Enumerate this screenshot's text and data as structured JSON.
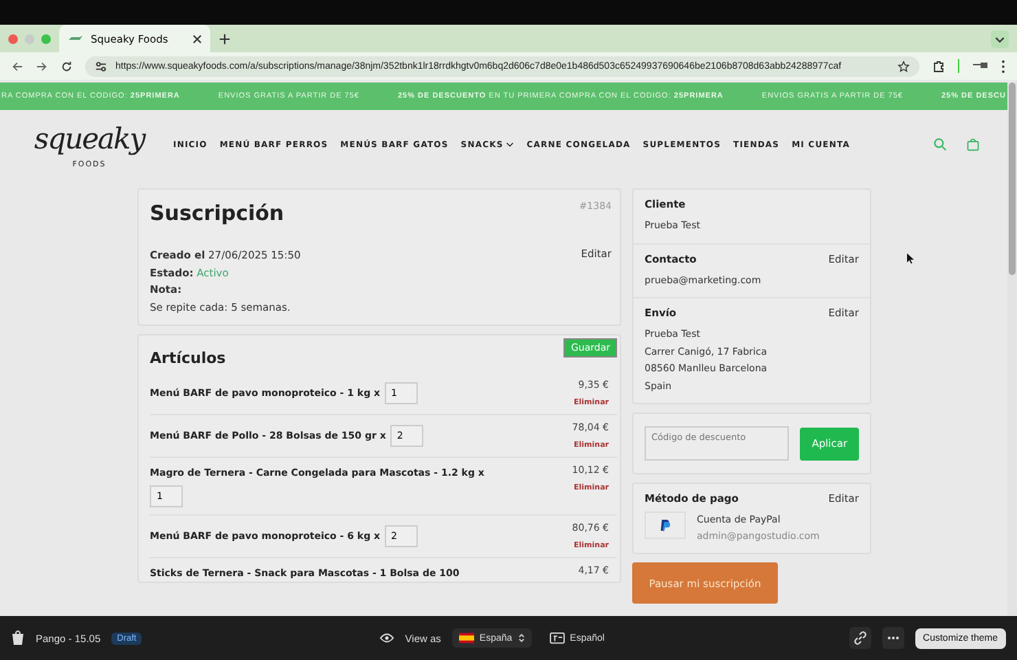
{
  "browser": {
    "tab_title": "Squeaky Foods",
    "url": "https://www.squeakyfoods.com/a/subscriptions/manage/38njm/352tbnk1lr18rrdkhgtv0m6bq2d606c7d8e0e1b486d503c65249937690646be2106b8708d63abb24288977caf"
  },
  "banner": [
    "RA COMPRA CON EL CODIGO: **25PRIMERA**",
    "ENVIOS GRATIS A PARTIR DE 75€",
    "**25% DE DESCUENTO** EN TU PRIMERA COMPRA CON EL CODIGO: **25PRIMERA**",
    "ENVIOS GRATIS A PARTIR DE 75€",
    "**25% DE DESCU**"
  ],
  "header": {
    "logo": "squeaky",
    "logo_sub": "FOODS",
    "nav": [
      {
        "label": "INICIO",
        "dropdown": false
      },
      {
        "label": "MENÚ BARF PERROS",
        "dropdown": false
      },
      {
        "label": "MENÚS BARF GATOS",
        "dropdown": false
      },
      {
        "label": "SNACKS",
        "dropdown": true
      },
      {
        "label": "CARNE CONGELADA",
        "dropdown": false
      },
      {
        "label": "SUPLEMENTOS",
        "dropdown": false
      },
      {
        "label": "TIENDAS",
        "dropdown": false
      },
      {
        "label": "MI CUENTA",
        "dropdown": false
      }
    ]
  },
  "subscription": {
    "title": "Suscripción",
    "number": "#1384",
    "edit": "Editar",
    "created_label": "Creado el",
    "created": "27/06/2025 15:50",
    "status_label": "Estado:",
    "status": "Activo",
    "note_label": "Nota:",
    "repeat": "Se repite cada: 5 semanas."
  },
  "items": {
    "title": "Artículos",
    "save": "Guardar",
    "rows": [
      {
        "name": "Menú BARF de pavo monoproteico - 1 kg x",
        "qty": "1",
        "price": "9,35 €",
        "remove": "Eliminar"
      },
      {
        "name": "Menú BARF de Pollo - 28 Bolsas de 150 gr x",
        "qty": "2",
        "price": "78,04 €",
        "remove": "Eliminar"
      },
      {
        "name": "Magro de Ternera - Carne Congelada para Mascotas - 1.2 kg x",
        "qty": "1",
        "price": "10,12 €",
        "remove": "Eliminar"
      },
      {
        "name": "Menú BARF de pavo monoproteico - 6 kg x",
        "qty": "2",
        "price": "80,76 €",
        "remove": "Eliminar"
      },
      {
        "name": "Sticks de Ternera - Snack para Mascotas - 1 Bolsa de 100",
        "price": "4,17 €"
      }
    ]
  },
  "customer": {
    "title": "Cliente",
    "name": "Prueba Test"
  },
  "contact": {
    "title": "Contacto",
    "edit": "Editar",
    "email": "prueba@marketing.com"
  },
  "shipping": {
    "title": "Envío",
    "edit": "Editar",
    "lines": [
      "Prueba Test",
      "Carrer Canigó, 17 Fabrica",
      "08560 Manlleu Barcelona",
      "Spain"
    ]
  },
  "discount": {
    "placeholder": "Código de descuento",
    "button": "Aplicar"
  },
  "payment": {
    "title": "Método de pago",
    "edit": "Editar",
    "method": "Cuenta de PayPal",
    "email": "admin@pangostudio.com"
  },
  "pause_button": "Pausar mi suscripción",
  "editor_bar": {
    "theme": "Pango - 15.05",
    "badge": "Draft",
    "view_as": "View as",
    "country": "España",
    "language": "Español",
    "customize": "Customize theme"
  }
}
